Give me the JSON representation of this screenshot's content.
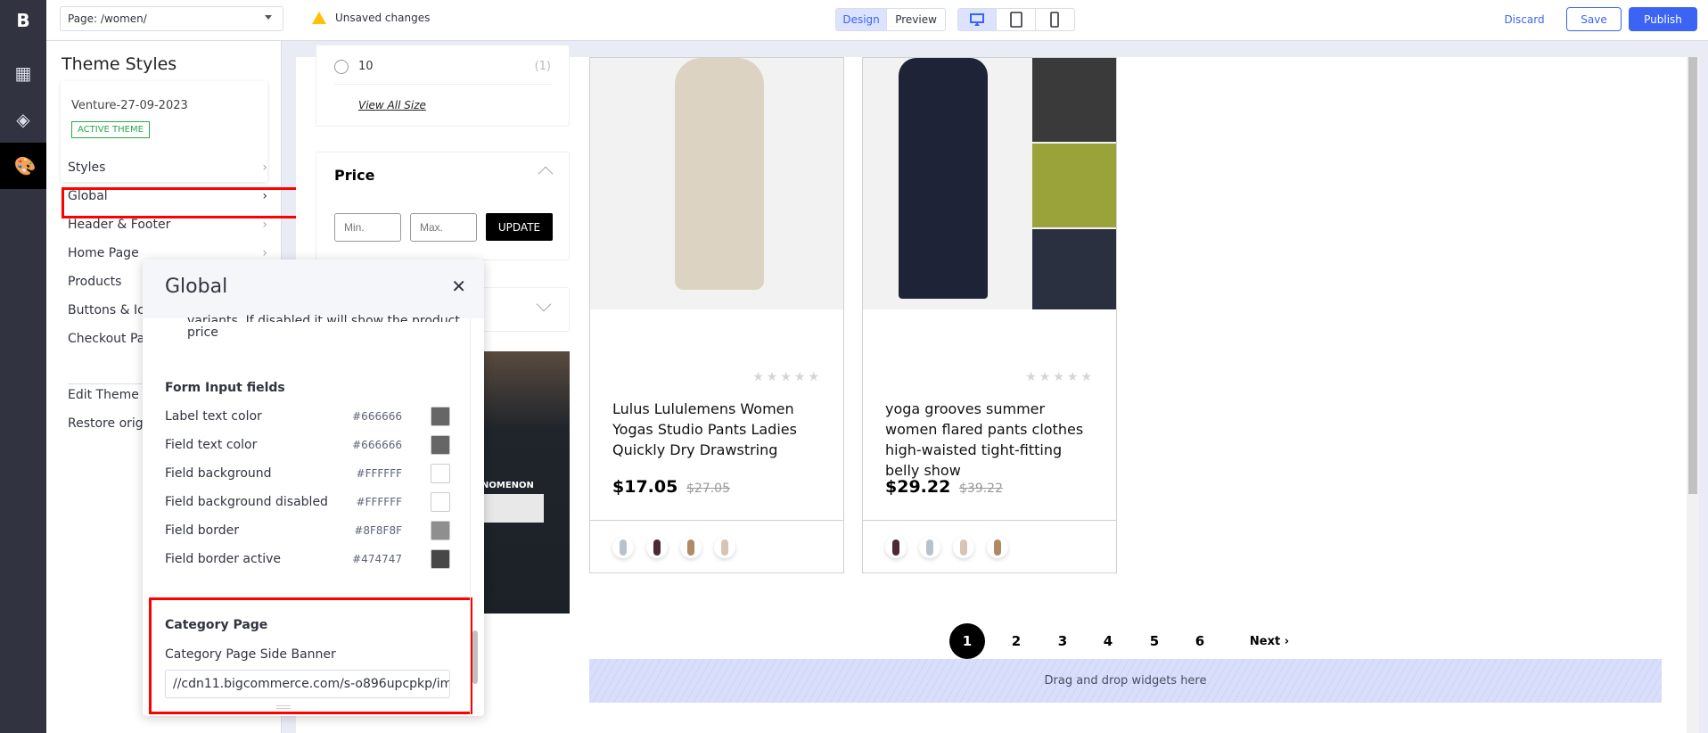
{
  "topbar": {
    "page_select": "Page: /women/",
    "unsaved": "Unsaved changes",
    "modes": [
      "Design",
      "Preview"
    ],
    "active_mode": "Design",
    "devices": [
      "desktop-icon",
      "tablet-icon",
      "mobile-icon"
    ],
    "discard": "Discard",
    "save": "Save",
    "publish": "Publish",
    "accent": "#3c64f4"
  },
  "leftnav": {
    "logo": "B",
    "icons": [
      "widgets-icon",
      "layers-icon",
      "palette-icon"
    ]
  },
  "sidebar": {
    "title": "Theme Styles",
    "theme_name": "Venture-27-09-2023",
    "active_badge": "ACTIVE THEME",
    "items": [
      {
        "label": "Styles"
      },
      {
        "label": "Global"
      },
      {
        "label": "Header & Footer"
      },
      {
        "label": "Home Page"
      },
      {
        "label": "Products"
      },
      {
        "label": "Buttons & Icons"
      },
      {
        "label": "Checkout Page"
      }
    ],
    "edit_theme": "Edit Theme Files",
    "restore": "Restore original theme styles"
  },
  "filters": {
    "size_option": "10",
    "size_count": "(1)",
    "view_all": "View All Size",
    "price_title": "Price",
    "min_placeholder": "Min.",
    "max_placeholder": "Max.",
    "update": "UPDATE"
  },
  "banner_text": "NOMENON",
  "products": [
    {
      "title": "Lulus Lululemens Women Yogas Studio Pants Ladies Quickly Dry Drawstring",
      "price": "$17.05",
      "old_price": "$27.05",
      "rating": 0
    },
    {
      "title": "yoga grooves summer women flared pants clothes high-waisted tight-fitting belly show",
      "price": "$29.22",
      "old_price": "$39.22",
      "rating": 0
    }
  ],
  "pagination": {
    "pages": [
      "1",
      "2",
      "3",
      "4",
      "5",
      "6"
    ],
    "current": "1",
    "next": "Next"
  },
  "dropzone": "Drag and drop widgets here",
  "global_panel": {
    "title": "Global",
    "cut_text_1": "variants. If disabled it will show the product",
    "cut_text_2": "price",
    "section": "Form Input fields",
    "fields": [
      {
        "label": "Label text color",
        "value": "#666666"
      },
      {
        "label": "Field text color",
        "value": "#666666"
      },
      {
        "label": "Field background",
        "value": "#FFFFFF"
      },
      {
        "label": "Field background disabled",
        "value": "#FFFFFF"
      },
      {
        "label": "Field border",
        "value": "#8F8F8F"
      },
      {
        "label": "Field border active",
        "value": "#474747"
      }
    ],
    "category_section": "Category Page",
    "banner_label": "Category Page Side Banner",
    "banner_value": "//cdn11.bigcommerce.com/s-o896upcpkp/im"
  }
}
